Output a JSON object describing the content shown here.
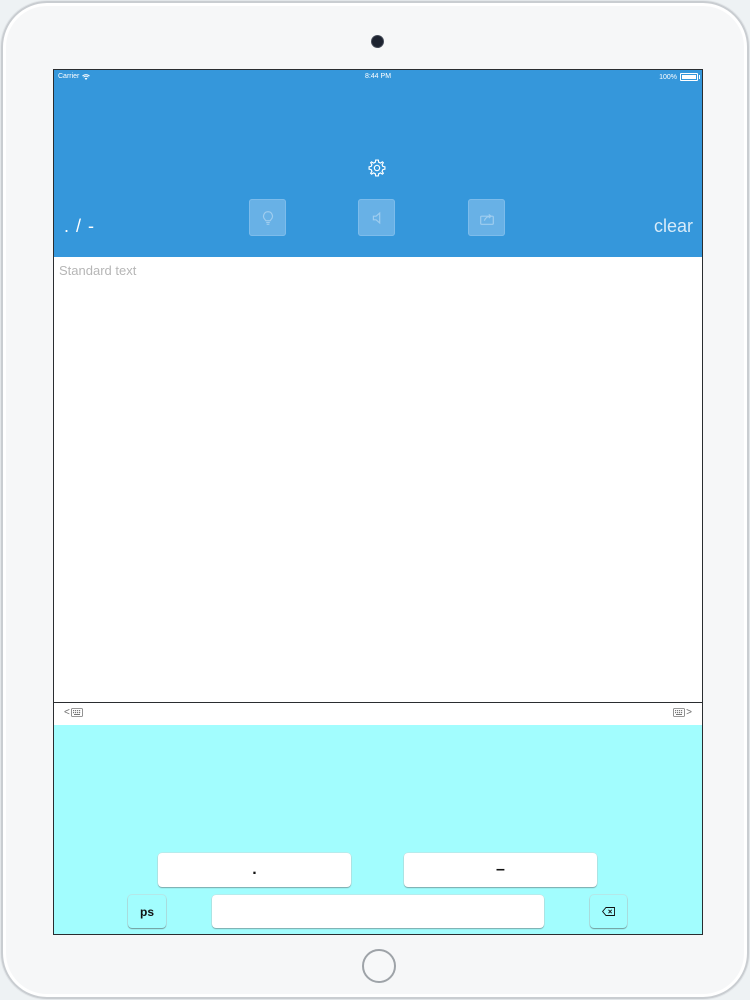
{
  "status_bar": {
    "carrier": "Carrier",
    "time": "8:44 PM",
    "battery": "100%"
  },
  "header": {
    "mode_label": ". / -",
    "clear_label": "clear",
    "settings_icon": "gear-icon",
    "tools": [
      {
        "icon": "lightbulb-icon"
      },
      {
        "icon": "speaker-icon"
      },
      {
        "icon": "share-icon"
      }
    ],
    "background_color": "#3597db"
  },
  "editor": {
    "placeholder": "Standard text"
  },
  "keyboard_bar": {
    "left_switch": "<",
    "right_switch": ">"
  },
  "keyboard": {
    "background_color": "#a2fdfe",
    "dot_key": ".",
    "dash_key": "–",
    "ps_key": "ps",
    "space_key": "",
    "delete_icon": "backspace-icon"
  }
}
